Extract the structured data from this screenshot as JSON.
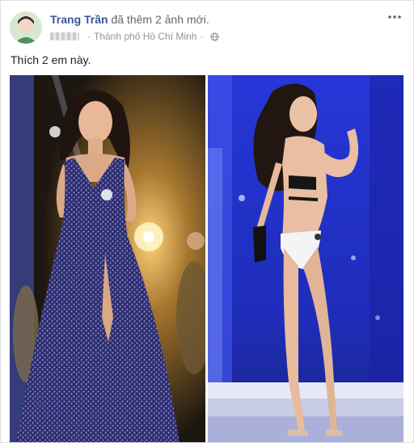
{
  "post": {
    "author": "Trang Trần",
    "action": "đã thêm 2 ảnh mới.",
    "location": "Thành phố Hồ Chí Minh",
    "separator": "·",
    "text": "Thích 2 em này.",
    "icons": {
      "more": "more-options-icon",
      "privacy": "globe-icon"
    }
  },
  "colors": {
    "author_link": "#365899",
    "meta_text": "#90949c",
    "left_photo_stage": "#2a2014",
    "right_photo_stage": "#1b2cc9"
  }
}
